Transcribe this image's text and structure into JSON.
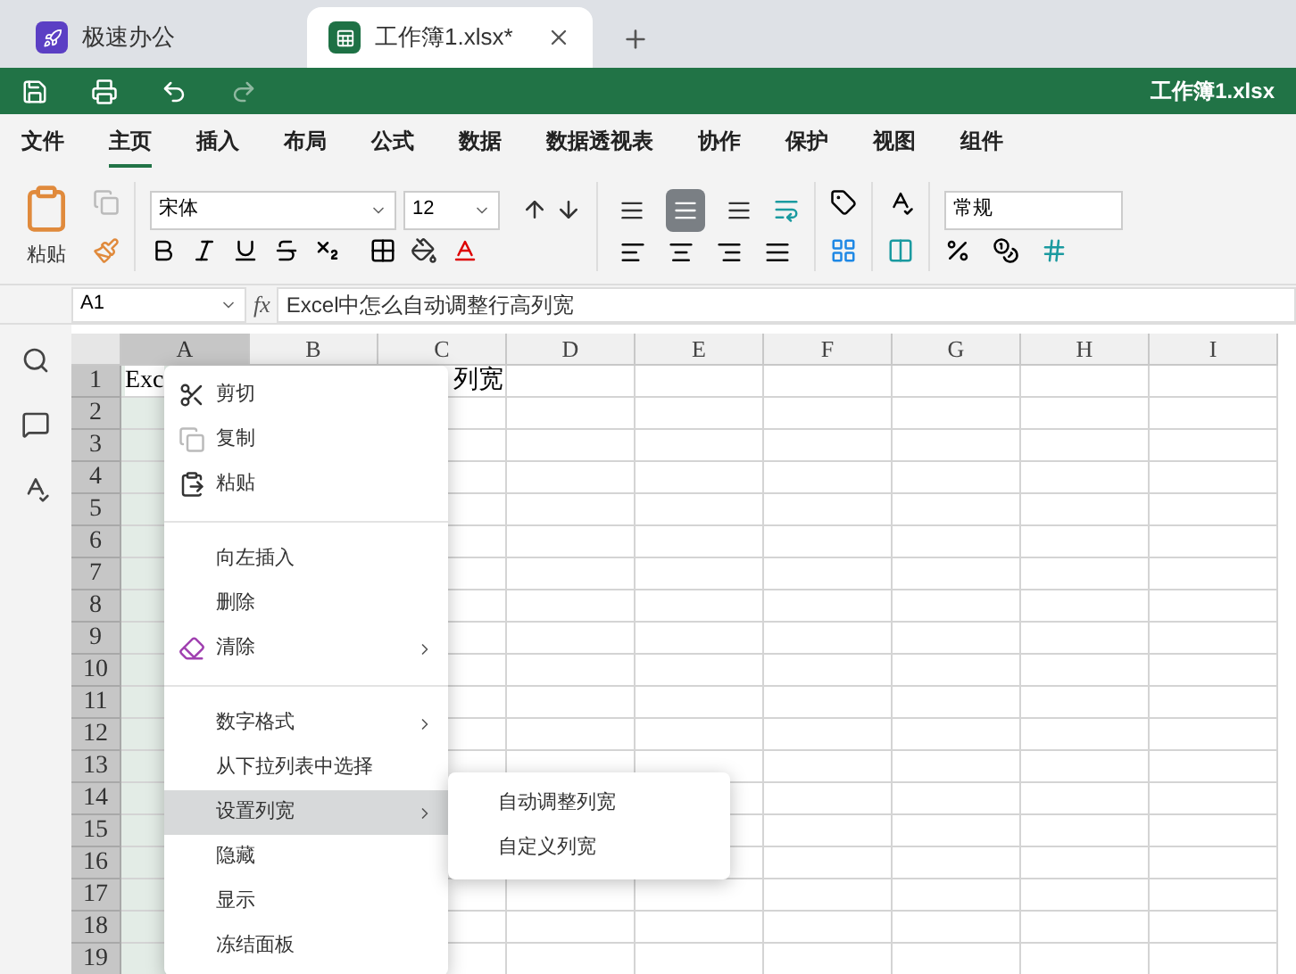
{
  "app_tabs": [
    {
      "label": "极速办公",
      "selected": false
    },
    {
      "label": "工作簿1.xlsx*",
      "selected": true
    }
  ],
  "quick_bar": {
    "title": "工作簿1.xlsx"
  },
  "menu_tabs": [
    {
      "label": "文件",
      "selected": false
    },
    {
      "label": "主页",
      "selected": true
    },
    {
      "label": "插入",
      "selected": false
    },
    {
      "label": "布局",
      "selected": false
    },
    {
      "label": "公式",
      "selected": false
    },
    {
      "label": "数据",
      "selected": false
    },
    {
      "label": "数据透视表",
      "selected": false
    },
    {
      "label": "协作",
      "selected": false
    },
    {
      "label": "保护",
      "selected": false
    },
    {
      "label": "视图",
      "selected": false
    },
    {
      "label": "组件",
      "selected": false
    }
  ],
  "ribbon": {
    "paste_label": "粘贴",
    "font": "宋体",
    "size": "12",
    "number_format": "常规",
    "vertical_align": [
      {
        "selected": false
      },
      {
        "selected": true
      },
      {
        "selected": false
      }
    ]
  },
  "formula_bar": {
    "cell_ref": "A1",
    "fx": "fx",
    "value": "Excel中怎么自动调整行高列宽"
  },
  "sheet": {
    "columns": [
      {
        "label": "A",
        "selected": true
      },
      {
        "label": "B",
        "selected": false
      },
      {
        "label": "C",
        "selected": false
      },
      {
        "label": "D",
        "selected": false
      },
      {
        "label": "E",
        "selected": false
      },
      {
        "label": "F",
        "selected": false
      },
      {
        "label": "G",
        "selected": false
      },
      {
        "label": "H",
        "selected": false
      },
      {
        "label": "I",
        "selected": false
      }
    ],
    "rows": [
      {
        "label": "1",
        "selected": true
      },
      {
        "label": "2",
        "selected": true
      },
      {
        "label": "3",
        "selected": true
      },
      {
        "label": "4",
        "selected": true
      },
      {
        "label": "5",
        "selected": true
      },
      {
        "label": "6",
        "selected": true
      },
      {
        "label": "7",
        "selected": true
      },
      {
        "label": "8",
        "selected": true
      },
      {
        "label": "9",
        "selected": true
      },
      {
        "label": "10",
        "selected": true
      },
      {
        "label": "11",
        "selected": true
      },
      {
        "label": "12",
        "selected": true
      },
      {
        "label": "13",
        "selected": true
      },
      {
        "label": "14",
        "selected": true
      },
      {
        "label": "15",
        "selected": true
      },
      {
        "label": "16",
        "selected": true
      },
      {
        "label": "17",
        "selected": true
      },
      {
        "label": "18",
        "selected": true
      },
      {
        "label": "19",
        "selected": true
      }
    ],
    "a1": {
      "left": "Exc",
      "right": "列宽"
    }
  },
  "context_menu": {
    "groups": [
      [
        {
          "label": "剪切",
          "submenu": false,
          "highlighted": false
        },
        {
          "label": "复制",
          "submenu": false,
          "highlighted": false
        },
        {
          "label": "粘贴",
          "submenu": false,
          "highlighted": false
        }
      ],
      [
        {
          "label": "向左插入",
          "submenu": false,
          "highlighted": false
        },
        {
          "label": "删除",
          "submenu": false,
          "highlighted": false
        },
        {
          "label": "清除",
          "submenu": true,
          "highlighted": false
        }
      ],
      [
        {
          "label": "数字格式",
          "submenu": true,
          "highlighted": false
        },
        {
          "label": "从下拉列表中选择",
          "submenu": false,
          "highlighted": false
        },
        {
          "label": "设置列宽",
          "submenu": true,
          "highlighted": true
        },
        {
          "label": "隐藏",
          "submenu": false,
          "highlighted": false
        },
        {
          "label": "显示",
          "submenu": false,
          "highlighted": false
        },
        {
          "label": "冻结面板",
          "submenu": false,
          "highlighted": false
        }
      ]
    ]
  },
  "submenu": {
    "items": [
      "自动调整列宽",
      "自定义列宽"
    ]
  }
}
